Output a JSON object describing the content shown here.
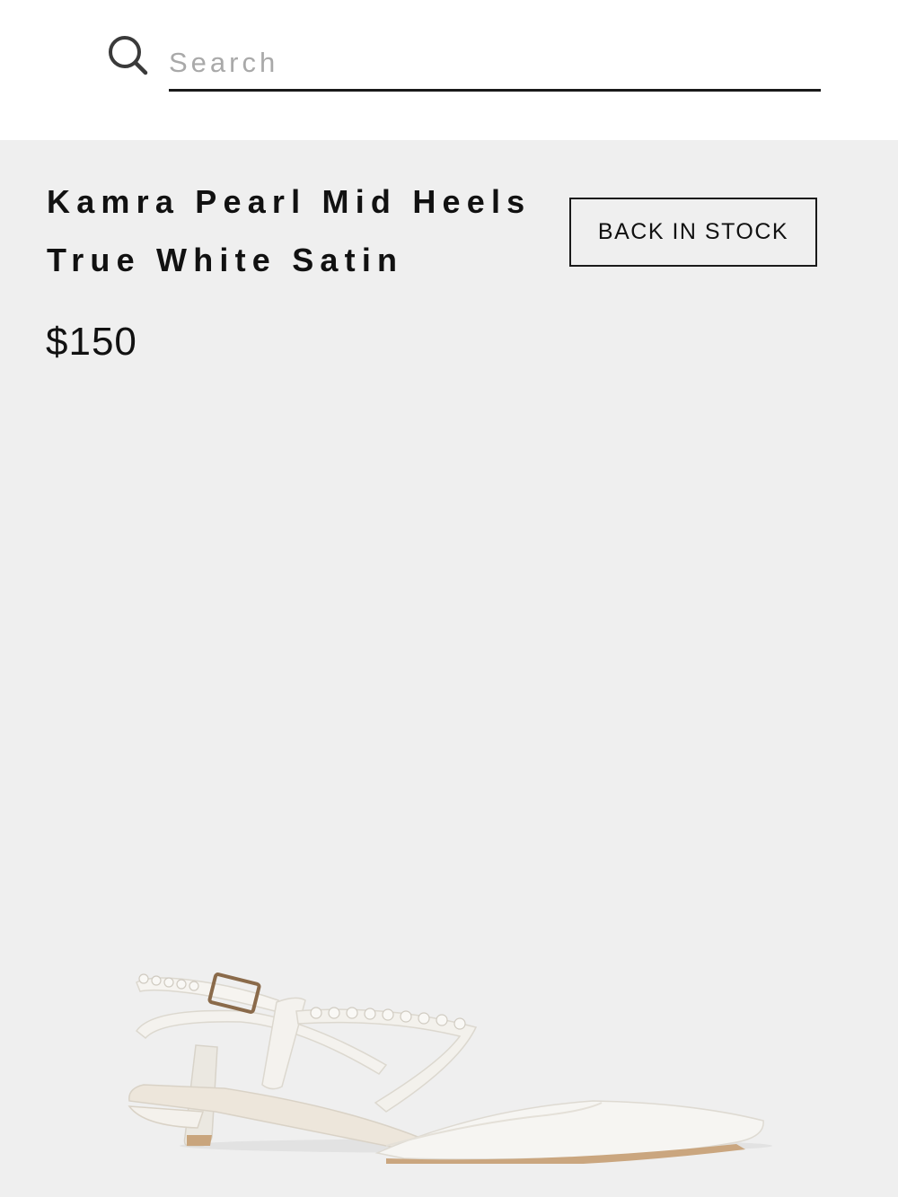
{
  "search": {
    "placeholder": "Search",
    "icon": "search-icon"
  },
  "product": {
    "title_line1": "Kamra Pearl Mid Heels",
    "title_line2": "True White Satin",
    "price": "$150",
    "badge": "BACK IN STOCK",
    "image_alt": "Kamra Pearl Mid Heels True White Satin"
  },
  "colors": {
    "header_bg": "#ffffff",
    "product_bg": "#efefef",
    "text": "#111111",
    "placeholder": "#a9a9a9"
  }
}
